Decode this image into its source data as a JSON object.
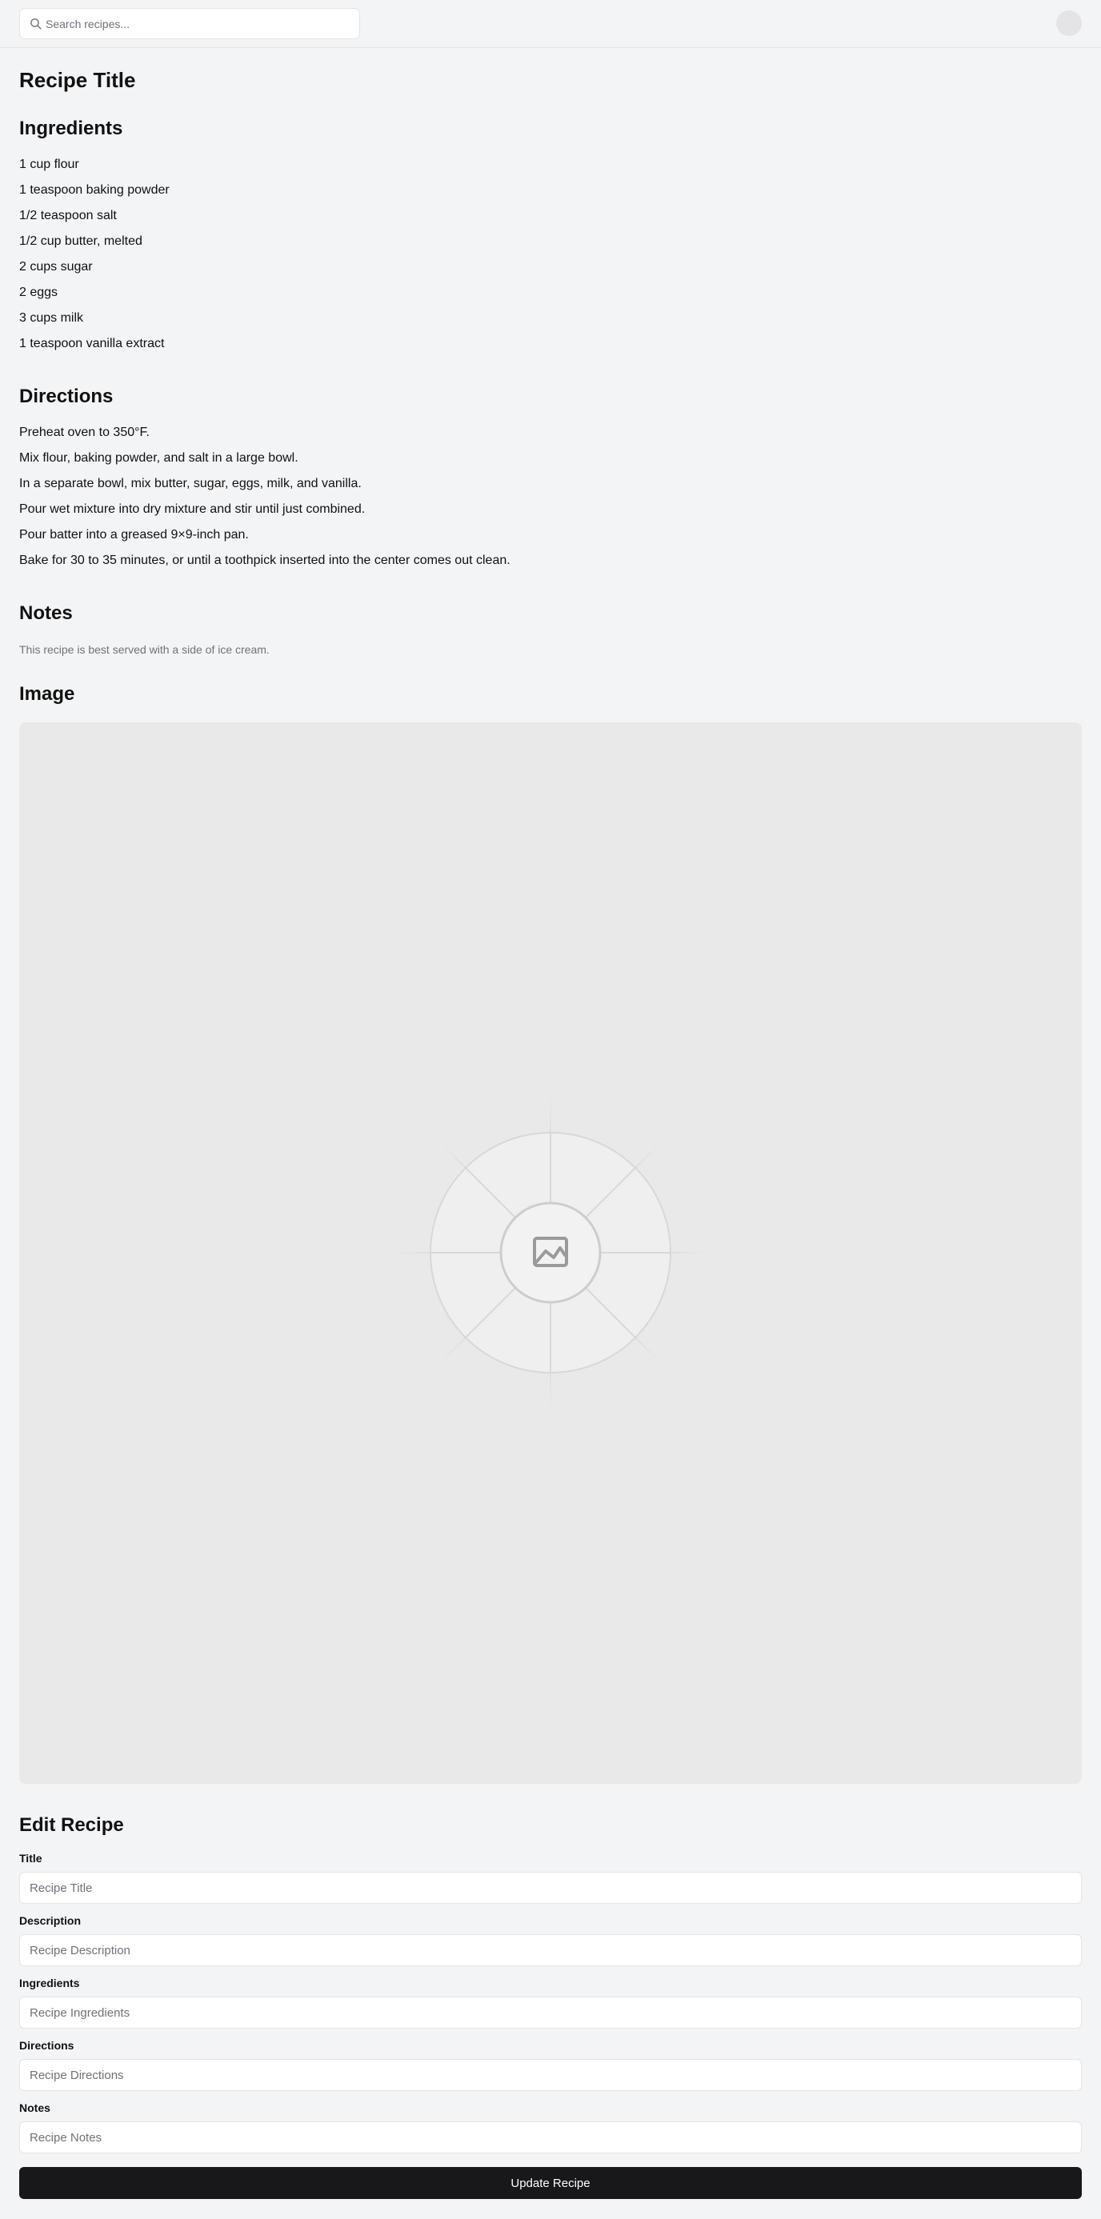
{
  "header": {
    "search_placeholder": "Search recipes...",
    "search_icon": "search-icon",
    "avatar_icon": "avatar"
  },
  "recipe": {
    "title": "Recipe Title",
    "ingredients_heading": "Ingredients",
    "ingredients": [
      "1 cup flour",
      "1 teaspoon baking powder",
      "1/2 teaspoon salt",
      "1/2 cup butter, melted",
      "2 cups sugar",
      "2 eggs",
      "3 cups milk",
      "1 teaspoon vanilla extract"
    ],
    "directions_heading": "Directions",
    "directions": [
      "Preheat oven to 350°F.",
      "Mix flour, baking powder, and salt in a large bowl.",
      "In a separate bowl, mix butter, sugar, eggs, milk, and vanilla.",
      "Pour wet mixture into dry mixture and stir until just combined.",
      "Pour batter into a greased 9×9-inch pan.",
      "Bake for 30 to 35 minutes, or until a toothpick inserted into the center comes out clean."
    ],
    "notes_heading": "Notes",
    "notes": "This recipe is best served with a side of ice cream.",
    "image_heading": "Image",
    "image_icon": "image-placeholder-icon"
  },
  "edit_form": {
    "heading": "Edit Recipe",
    "fields": [
      {
        "label": "Title",
        "placeholder": "Recipe Title",
        "value": ""
      },
      {
        "label": "Description",
        "placeholder": "Recipe Description",
        "value": ""
      },
      {
        "label": "Ingredients",
        "placeholder": "Recipe Ingredients",
        "value": ""
      },
      {
        "label": "Directions",
        "placeholder": "Recipe Directions",
        "value": ""
      },
      {
        "label": "Notes",
        "placeholder": "Recipe Notes",
        "value": ""
      }
    ],
    "submit_label": "Update Recipe"
  },
  "colors": {
    "page_background": "#f3f4f6",
    "button_background": "#18181b",
    "button_text": "#ffffff",
    "muted_text": "#71717a",
    "border": "#e4e4e7",
    "image_placeholder": "#e9e9e9"
  }
}
